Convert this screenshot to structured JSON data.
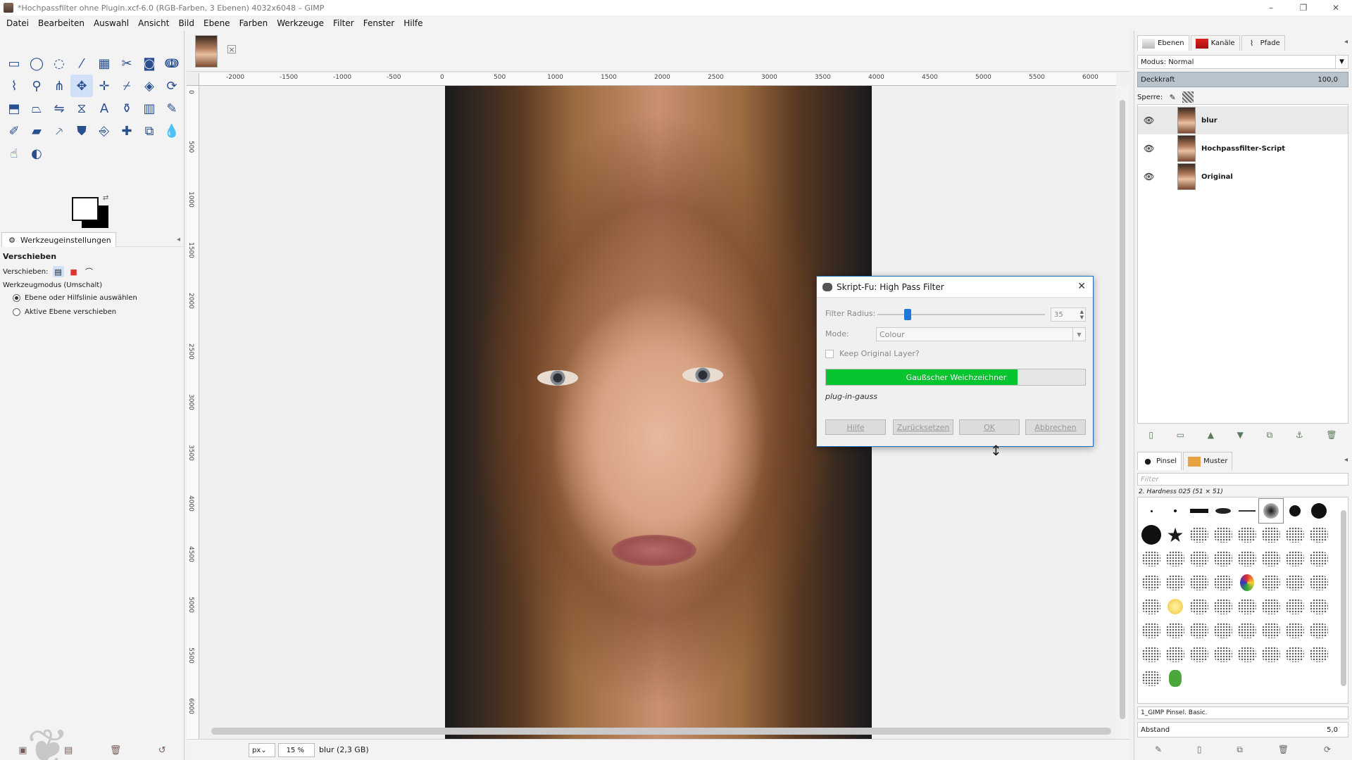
{
  "window": {
    "title": "*Hochpassfilter ohne Plugin.xcf-6.0 (RGB-Farben, 3 Ebenen) 4032x6048 – GIMP",
    "controls": [
      "–",
      "❐",
      "✕"
    ]
  },
  "menubar": [
    "Datei",
    "Bearbeiten",
    "Auswahl",
    "Ansicht",
    "Bild",
    "Ebene",
    "Farben",
    "Werkzeuge",
    "Filter",
    "Fenster",
    "Hilfe"
  ],
  "toolbox": {
    "tools": [
      {
        "icon": "rect-select-icon",
        "glyph": "▭"
      },
      {
        "icon": "ellipse-select-icon",
        "glyph": "◯"
      },
      {
        "icon": "lasso-icon",
        "glyph": "◌"
      },
      {
        "icon": "fuzzy-select-icon",
        "glyph": "⁄"
      },
      {
        "icon": "color-select-icon",
        "glyph": "▦"
      },
      {
        "icon": "scissors-icon",
        "glyph": "✂"
      },
      {
        "icon": "foreground-select-icon",
        "glyph": "◙"
      },
      {
        "icon": "paths-icon",
        "glyph": "ↈ"
      },
      {
        "icon": "color-picker-icon",
        "glyph": "⌇"
      },
      {
        "icon": "zoom-icon",
        "glyph": "⚲"
      },
      {
        "icon": "measure-icon",
        "glyph": "⋔"
      },
      {
        "icon": "move-icon",
        "glyph": "✥",
        "active": true
      },
      {
        "icon": "align-icon",
        "glyph": "✛"
      },
      {
        "icon": "crop-icon",
        "glyph": "⌿"
      },
      {
        "icon": "unified-transform-icon",
        "glyph": "◈"
      },
      {
        "icon": "rotate-icon",
        "glyph": "⟳"
      },
      {
        "icon": "warp-icon",
        "glyph": "⬒"
      },
      {
        "icon": "perspective-icon",
        "glyph": "⏢"
      },
      {
        "icon": "flip-icon",
        "glyph": "⇋"
      },
      {
        "icon": "cage-icon",
        "glyph": "⧖"
      },
      {
        "icon": "text-icon",
        "glyph": "A"
      },
      {
        "icon": "bucket-fill-icon",
        "glyph": "⚱"
      },
      {
        "icon": "gradient-icon",
        "glyph": "▥"
      },
      {
        "icon": "pencil-icon",
        "glyph": "✎"
      },
      {
        "icon": "paintbrush-icon",
        "glyph": "✐"
      },
      {
        "icon": "eraser-icon",
        "glyph": "▰"
      },
      {
        "icon": "airbrush-icon",
        "glyph": "⸕"
      },
      {
        "icon": "ink-icon",
        "glyph": "⛊"
      },
      {
        "icon": "clone-icon",
        "glyph": "⎆"
      },
      {
        "icon": "heal-icon",
        "glyph": "✚"
      },
      {
        "icon": "perspective-clone-icon",
        "glyph": "⧉"
      },
      {
        "icon": "blur-icon",
        "glyph": "💧"
      },
      {
        "icon": "smudge-icon",
        "glyph": "☝"
      },
      {
        "icon": "dodge-burn-icon",
        "glyph": "◐"
      }
    ],
    "tool_options_tab": "Werkzeugeinstellungen",
    "tool_name": "Verschieben",
    "move_label": "Verschieben:",
    "mode_label": "Werkzeugmodus (Umschalt)",
    "mode_options": [
      "Ebene oder Hilfslinie auswählen",
      "Aktive Ebene verschieben"
    ]
  },
  "rulers": {
    "h_ticks": [
      "-2000",
      "-1500",
      "-1000",
      "-500",
      "0",
      "500",
      "1000",
      "1500",
      "2000",
      "2500",
      "3000",
      "3500",
      "4000",
      "4500",
      "5000",
      "5500",
      "6000"
    ],
    "v_ticks": [
      "0",
      "500",
      "1000",
      "1500",
      "2000",
      "2500",
      "3000",
      "3500",
      "4000",
      "4500",
      "5000",
      "5500",
      "6000"
    ]
  },
  "statusbar": {
    "unit": "px",
    "zoom": "15 %",
    "text": "blur (2,3 GB)"
  },
  "layers_dock": {
    "tabs": [
      "Ebenen",
      "Kanäle",
      "Pfade"
    ],
    "mode_label": "Modus: Normal",
    "opacity_label": "Deckkraft",
    "opacity_value": "100,0",
    "lock_label": "Sperre:",
    "layers": [
      {
        "name": "blur",
        "selected": true
      },
      {
        "name": "Hochpassfilter-Script",
        "selected": false
      },
      {
        "name": "Original",
        "selected": false
      }
    ]
  },
  "brushes_dock": {
    "tabs": [
      "Pinsel",
      "Muster"
    ],
    "filter_placeholder": "Filter",
    "brush_name": "2. Hardness 025 (51 × 51)",
    "brush_set": "1_GIMP Pinsel. Basic.",
    "spacing_label": "Abstand",
    "spacing_value": "5,0"
  },
  "dialog": {
    "title": "Skript-Fu: High Pass Filter",
    "radius_label": "Filter Radius:",
    "radius_value": "35",
    "radius_fraction": 0.16,
    "mode_label": "Mode:",
    "mode_value": "Colour",
    "keep_label": "Keep Original Layer?",
    "progress_text": "Gaußscher Weichzeichner",
    "progress_fraction": 0.74,
    "procedure": "plug-in-gauss",
    "buttons": [
      "Hilfe",
      "Zurücksetzen",
      "OK",
      "Abbrechen"
    ]
  },
  "colors": {
    "accent": "#1a6ab8",
    "progress_green": "#06c52f",
    "opacity_bar": "#b9c3cc"
  }
}
